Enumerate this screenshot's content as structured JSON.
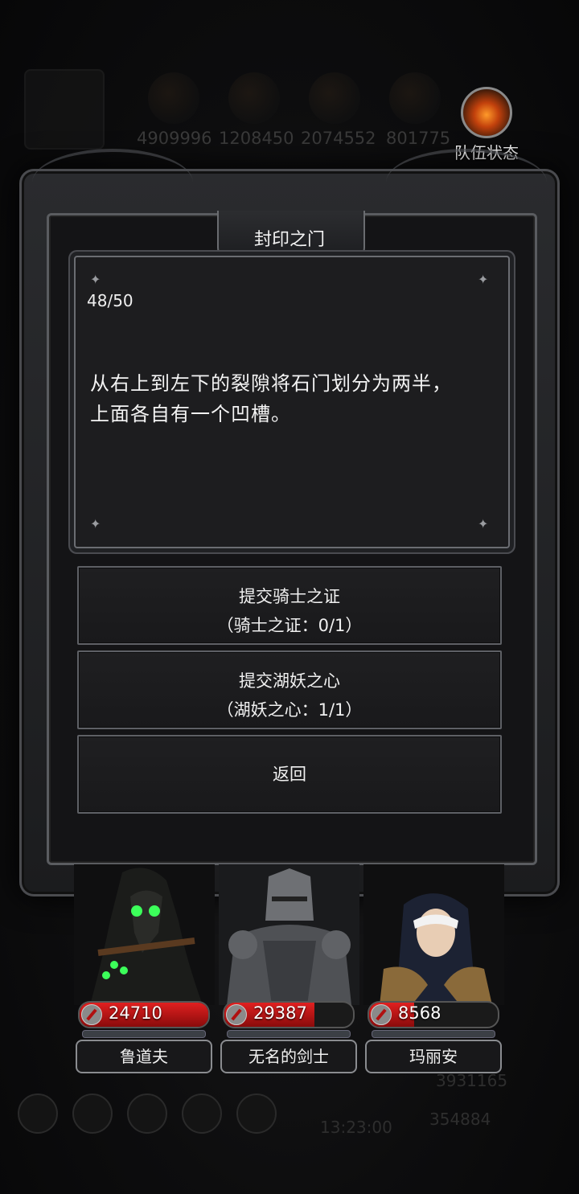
{
  "background": {
    "resources": [
      "4909996",
      "1208450",
      "2074552",
      "801775"
    ],
    "bottom_time": "13:23:00",
    "bottom_values": [
      "3931165",
      "354884"
    ]
  },
  "team_status": {
    "label": "队伍状态"
  },
  "dialog": {
    "title": "封印之门",
    "progress": "48/50",
    "description_lines": [
      "从右上到左下的裂隙将石门划分为两半，",
      "上面各自有一个凹槽。"
    ],
    "options": [
      {
        "label": "提交骑士之证",
        "requirement": "（骑士之证：0/1）"
      },
      {
        "label": "提交湖妖之心",
        "requirement": "（湖妖之心：1/1）"
      },
      {
        "label": "返回",
        "requirement": ""
      }
    ]
  },
  "party": [
    {
      "name": "鲁道夫",
      "hp": "24710",
      "hp_fraction": 1.0
    },
    {
      "name": "无名的剑士",
      "hp": "29387",
      "hp_fraction": 0.7
    },
    {
      "name": "玛丽安",
      "hp": "8568",
      "hp_fraction": 0.35
    }
  ],
  "colors": {
    "hp_red": "#d21b1b",
    "frame_border": "#5e6065",
    "text": "#f0f0f0"
  }
}
